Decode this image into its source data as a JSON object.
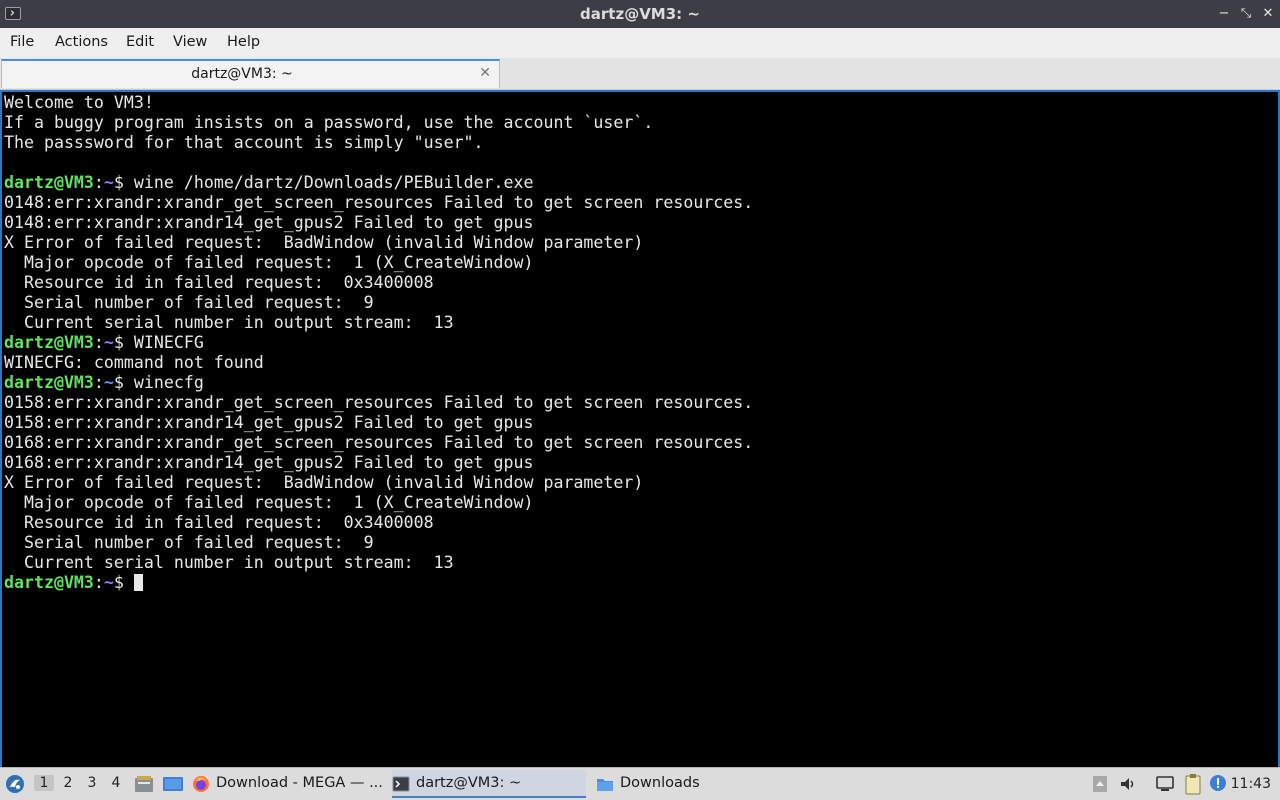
{
  "window": {
    "title": "dartz@VM3: ~",
    "controls": [
      "−",
      "⤡",
      "✕"
    ]
  },
  "menu": [
    "File",
    "Actions",
    "Edit",
    "View",
    "Help"
  ],
  "tab": {
    "label": "dartz@VM3: ~",
    "close": "✕"
  },
  "terminal": {
    "prompt_user": "dartz@VM3",
    "prompt_sep": ":",
    "prompt_path": "~",
    "prompt_dollar": "$ ",
    "lines": [
      {
        "kind": "text",
        "text": "Welcome to VM3!"
      },
      {
        "kind": "text",
        "text": "If a buggy program insists on a password, use the account `user`."
      },
      {
        "kind": "text",
        "text": "The passsword for that account is simply \"user\"."
      },
      {
        "kind": "text",
        "text": ""
      },
      {
        "kind": "prompt",
        "cmd": "wine /home/dartz/Downloads/PEBuilder.exe"
      },
      {
        "kind": "text",
        "text": "0148:err:xrandr:xrandr_get_screen_resources Failed to get screen resources."
      },
      {
        "kind": "text",
        "text": "0148:err:xrandr:xrandr14_get_gpus2 Failed to get gpus"
      },
      {
        "kind": "text",
        "text": "X Error of failed request:  BadWindow (invalid Window parameter)"
      },
      {
        "kind": "text",
        "text": "  Major opcode of failed request:  1 (X_CreateWindow)"
      },
      {
        "kind": "text",
        "text": "  Resource id in failed request:  0x3400008"
      },
      {
        "kind": "text",
        "text": "  Serial number of failed request:  9"
      },
      {
        "kind": "text",
        "text": "  Current serial number in output stream:  13"
      },
      {
        "kind": "prompt",
        "cmd": "WINECFG"
      },
      {
        "kind": "text",
        "text": "WINECFG: command not found"
      },
      {
        "kind": "prompt",
        "cmd": "winecfg"
      },
      {
        "kind": "text",
        "text": "0158:err:xrandr:xrandr_get_screen_resources Failed to get screen resources."
      },
      {
        "kind": "text",
        "text": "0158:err:xrandr:xrandr14_get_gpus2 Failed to get gpus"
      },
      {
        "kind": "text",
        "text": "0168:err:xrandr:xrandr_get_screen_resources Failed to get screen resources."
      },
      {
        "kind": "text",
        "text": "0168:err:xrandr:xrandr14_get_gpus2 Failed to get gpus"
      },
      {
        "kind": "text",
        "text": "X Error of failed request:  BadWindow (invalid Window parameter)"
      },
      {
        "kind": "text",
        "text": "  Major opcode of failed request:  1 (X_CreateWindow)"
      },
      {
        "kind": "text",
        "text": "  Resource id in failed request:  0x3400008"
      },
      {
        "kind": "text",
        "text": "  Serial number of failed request:  9"
      },
      {
        "kind": "text",
        "text": "  Current serial number in output stream:  13"
      },
      {
        "kind": "prompt",
        "cmd": "",
        "cursor": true
      }
    ]
  },
  "taskbar": {
    "workspaces": [
      "1",
      "2",
      "3",
      "4"
    ],
    "active_workspace": "1",
    "tasks": [
      {
        "label": "Download - MEGA — ...",
        "icon": "firefox-icon"
      },
      {
        "label": "dartz@VM3: ~",
        "icon": "terminal-icon",
        "active": true
      },
      {
        "label": "Downloads",
        "icon": "folder-icon"
      }
    ],
    "clock": "11:43"
  }
}
